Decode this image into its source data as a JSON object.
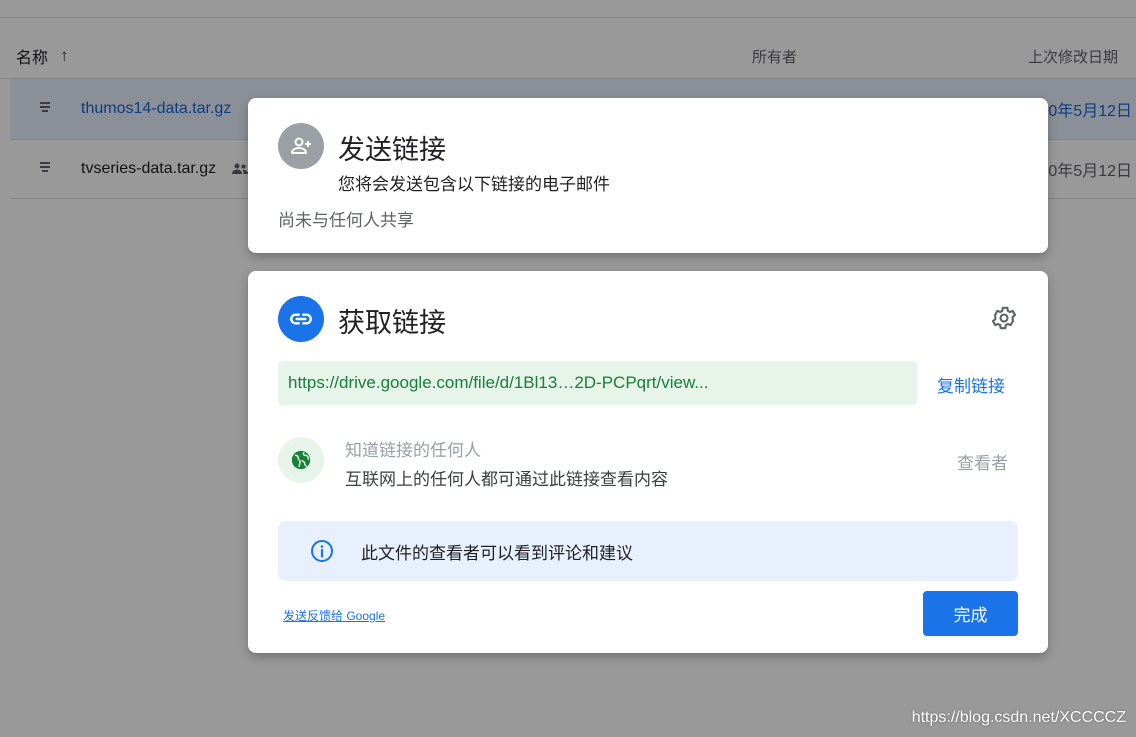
{
  "file_list": {
    "header": {
      "name": "名称",
      "owner": "所有者",
      "modified": "上次修改日期"
    },
    "rows": [
      {
        "name": "thumos14-data.tar.gz",
        "date": "0年5月12日",
        "selected": true
      },
      {
        "name": "tvseries-data.tar.gz",
        "date": "0年5月12日",
        "selected": false
      }
    ]
  },
  "send_dialog": {
    "icon": "person-add-icon",
    "title": "发送链接",
    "description": "您将会发送包含以下链接的电子邮件",
    "share_status": "尚未与任何人共享"
  },
  "link_dialog": {
    "icon": "link-icon",
    "title": "获取链接",
    "settings_icon": "gear-icon",
    "url": "https://drive.google.com/file/d/1Bl13…2D-PCPqrt/view...",
    "copy_label": "复制链接",
    "access": {
      "icon": "globe-icon",
      "type": "知道链接的任何人",
      "description": "互联网上的任何人都可通过此链接查看内容",
      "role": "查看者"
    },
    "info": {
      "icon": "info-icon",
      "text": "此文件的查看者可以看到评论和建议"
    },
    "feedback_label": "发送反馈给 Google",
    "done_label": "完成"
  },
  "watermark": "https://blog.csdn.net/XCCCCZ",
  "colors": {
    "accent": "#1a73e8",
    "url_bg": "#e6f4ea",
    "url_text": "#188038",
    "info_bg": "#e8f0fe"
  }
}
